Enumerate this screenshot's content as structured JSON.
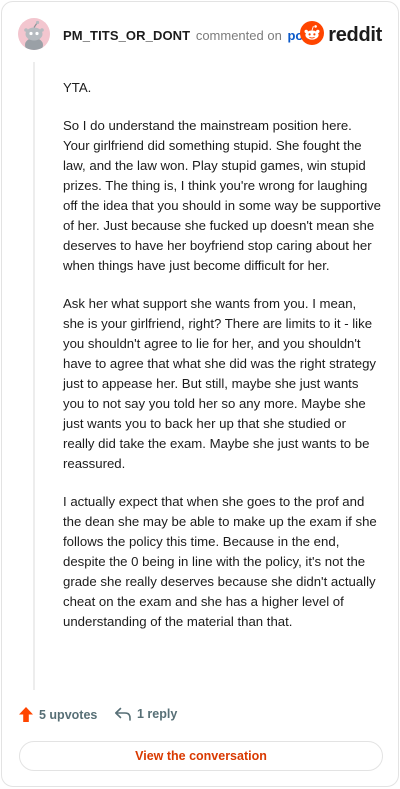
{
  "colors": {
    "brand": "#ff4500",
    "link": "#0b59c9",
    "cta_text": "#d93900",
    "muted": "#7c7c7c"
  },
  "header": {
    "author": "PM_TITS_OR_DONT",
    "commented_on": "commented on",
    "post_link": "post",
    "brand_name": "reddit",
    "avatar_icon": "snoo-avatar-icon",
    "brand_icon": "reddit-logo-icon"
  },
  "comment": {
    "paragraphs": [
      "YTA.",
      "So I do understand the mainstream position here. Your girlfriend did something stupid. She fought the law, and the law won. Play stupid games, win stupid prizes. The thing is, I think you're wrong for laughing off the idea that you should in some way be supportive of her. Just because she fucked up doesn't mean she deserves to have her boyfriend stop caring about her when things have just become difficult for her.",
      "Ask her what support she wants from you. I mean, she is your girlfriend, right? There are limits to it - like you shouldn't agree to lie for her, and you shouldn't have to agree that what she did was the right strategy just to appease her. But still, maybe she just wants you to not say you told her so any more. Maybe she just wants you to back her up that she studied or really did take the exam. Maybe she just wants to be reassured.",
      "I actually expect that when she goes to the prof and the dean she may be able to make up the exam if she follows the policy this time. Because in the end, despite the 0 being in line with the policy, it's not the grade she really deserves because she didn't actually cheat on the exam and she has a higher level of understanding of the material than that."
    ]
  },
  "actions": {
    "upvotes_label": "5 upvotes",
    "replies_label": "1 reply",
    "upvote_icon": "upvote-arrow-icon",
    "reply_icon": "reply-arrow-icon",
    "view_conversation": "View the conversation"
  }
}
